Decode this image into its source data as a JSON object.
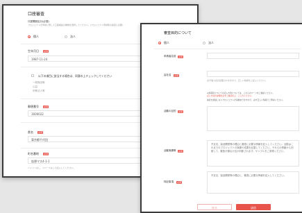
{
  "left_window": {
    "title": "口座審査",
    "classification_label": "口座開設区分(必須)",
    "classification_note": "プロジェクトを申請に際して口座開設の種類を選択してください。(プロジェクト申請時の審査に必要)",
    "option_individual": "個人",
    "option_corporate": "法人",
    "birthdate_label": "生年月日",
    "birthdate_value": "1987-11-24",
    "checkbox_text": "以下の項目に該当する場合は、同意の上チェックしてください",
    "bullets": [
      "一般財団等",
      "公益",
      "宗教法人等"
    ],
    "postal_label": "郵便番号",
    "postal_value": "1600022",
    "pref_label": "県名",
    "pref_value": "東京都千代田",
    "address_label": "町名番地",
    "address_value": "仮想マス4-1-1",
    "address_note": "ハイフンなし、スペースなしで記入してください。",
    "required_badge": "必須"
  },
  "right_window": {
    "title": "審査目的について",
    "option_individual": "個人",
    "option_corporate": "法人",
    "field1_label": "申請者名前",
    "field2_label": "会社名",
    "field2_note": "必ず個人名が記載されますので、正しい情報をご記入ください。",
    "info_line1": "※各項目についての記入方法については、こちらのページをご確認ください。",
    "info_line2": "記入方法の詳細を必ずご確認の上、ご入力ください。",
    "info_line3": "審査を通過しないプロジェクトが多数ありますので、必ず正しい情報でご申請ください。",
    "field3_label": "活動の目的",
    "field4_label": "活動実績等",
    "field4_text": "不定法、製品開発等の理由と審査に必要な情報を記入してください。活動はこれまでのプロジェクトの実績や成果を記載してください。それらの情報から判断して、審査が通るか否か判断されます。サンプルをご参照ください。",
    "field5_label": "特記事項",
    "field5_text": "不定法、製品開発等の理由と、審査に必要な情報を記入してください。",
    "cancel_label": "戻る",
    "submit_label": "送信",
    "required_badge": "必須"
  },
  "colors": {
    "accent": "#e8534a",
    "background": "#e6e6e6",
    "window_border": "#3a3a3a"
  }
}
